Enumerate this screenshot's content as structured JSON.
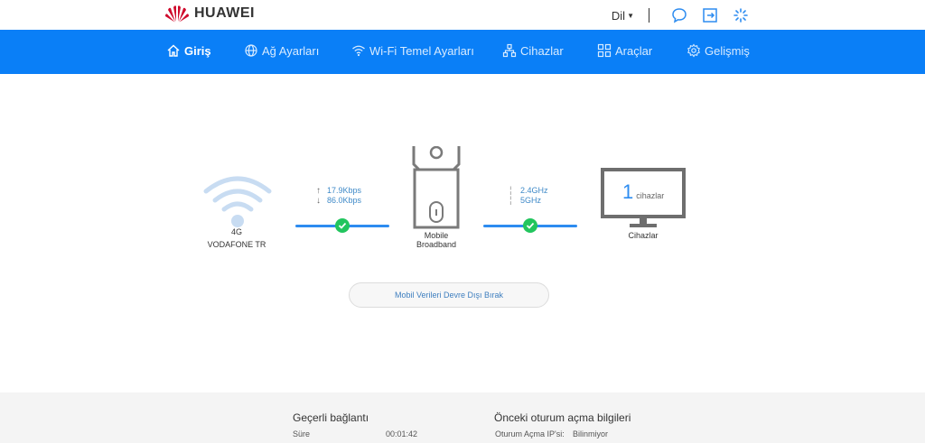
{
  "brand": {
    "name": "HUAWEI"
  },
  "topbar": {
    "language_label": "Dil"
  },
  "nav": [
    {
      "label": "Giriş",
      "icon": "home-icon",
      "active": true
    },
    {
      "label": "Ağ Ayarları",
      "icon": "globe-icon"
    },
    {
      "label": "Wi-Fi Temel Ayarları",
      "icon": "wifi-icon"
    },
    {
      "label": "Cihazlar",
      "icon": "devices-icon"
    },
    {
      "label": "Araçlar",
      "icon": "tools-icon"
    },
    {
      "label": "Gelişmiş",
      "icon": "gear-icon"
    }
  ],
  "status": {
    "network_type": "4G",
    "operator": "VODAFONE TR",
    "upload_speed": "17.9Kbps",
    "download_speed": "86.0Kbps",
    "device_label_line1": "Mobile",
    "device_label_line2": "Broadband",
    "band_1": "2.4GHz",
    "band_2": "5GHz",
    "device_count": "1",
    "device_count_unit": "cihazlar",
    "devices_label": "Cihazlar"
  },
  "actions": {
    "disable_data": "Mobil Verileri Devre Dışı Bırak"
  },
  "current_connection": {
    "title": "Geçerli bağlantı",
    "duration_label": "Süre",
    "duration_value": "00:01:42"
  },
  "previous_login": {
    "title": "Önceki oturum açma bilgileri",
    "ip_label": "Oturum Açma IP'si:",
    "ip_value": "Bilinmiyor"
  },
  "colors": {
    "nav_bg": "#0a7ff7",
    "accent": "#2d8cf0",
    "ok": "#22c55e",
    "brand_red": "#cf0a2c"
  }
}
